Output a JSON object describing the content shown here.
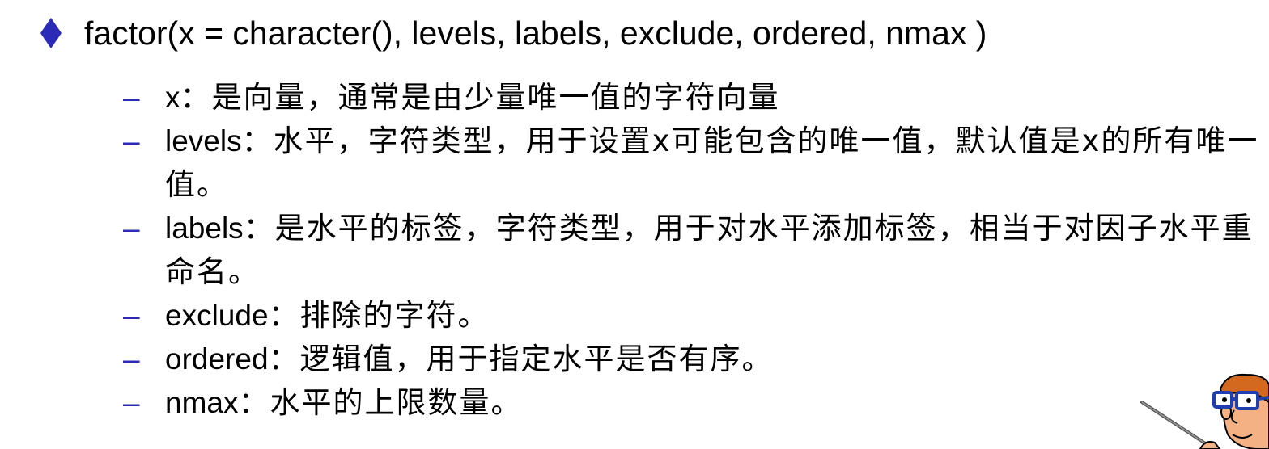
{
  "main": {
    "text": "factor(x = character(), levels, labels, exclude, ordered, nmax )"
  },
  "items": [
    {
      "term": "x",
      "desc": "：是向量，通常是由少量唯一值的字符向量"
    },
    {
      "term": "levels",
      "desc": "：水平，字符类型，用于设置x可能包含的唯一值，默认值是x的所有唯一值。"
    },
    {
      "term": "labels",
      "desc": "：是水平的标签，字符类型，用于对水平添加标签，相当于对因子水平重命名。"
    },
    {
      "term": "exclude",
      "desc": "：排除的字符。"
    },
    {
      "term": "ordered",
      "desc": "：逻辑值，用于指定水平是否有序。"
    },
    {
      "term": "nmax",
      "desc": "：水平的上限数量。"
    }
  ],
  "colors": {
    "bullet": "#2b2bb8",
    "dash": "#2b2bb8",
    "text": "#000000"
  },
  "icons": {
    "bullet": "diamond-icon",
    "decoration": "professor-cartoon-icon"
  }
}
